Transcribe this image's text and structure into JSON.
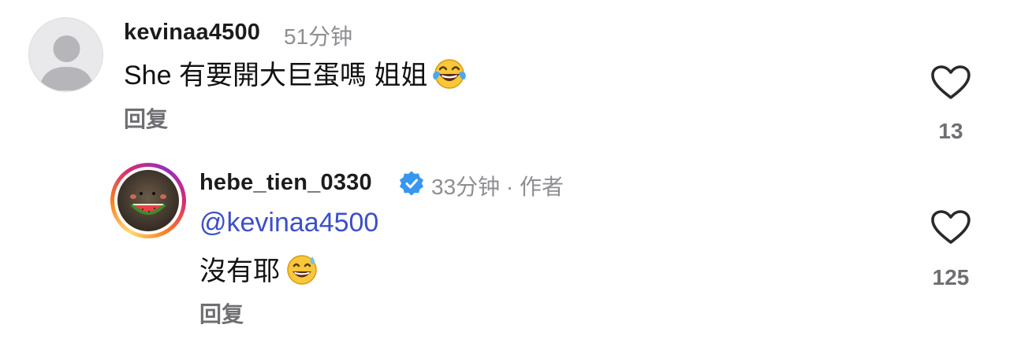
{
  "comments": [
    {
      "username": "kevinaa4500",
      "time": "51分钟",
      "text": "She 有要開大巨蛋嗎 姐姐",
      "reply_label": "回复",
      "likes": "13",
      "emoji_icon": "face-with-tears-of-joy-icon"
    },
    {
      "username": "hebe_tien_0330",
      "verified": true,
      "time_author": "33分钟 · 作者",
      "mention": "@kevinaa4500",
      "text": "沒有耶",
      "reply_label": "回复",
      "likes": "125",
      "emoji_icon": "grinning-face-with-sweat-icon"
    }
  ],
  "colors": {
    "username": "#1c1c1e",
    "meta": "#8e8e93",
    "mention": "#3c4fc8",
    "verified_badge": "#3797f0",
    "reply": "#6f6f73"
  }
}
